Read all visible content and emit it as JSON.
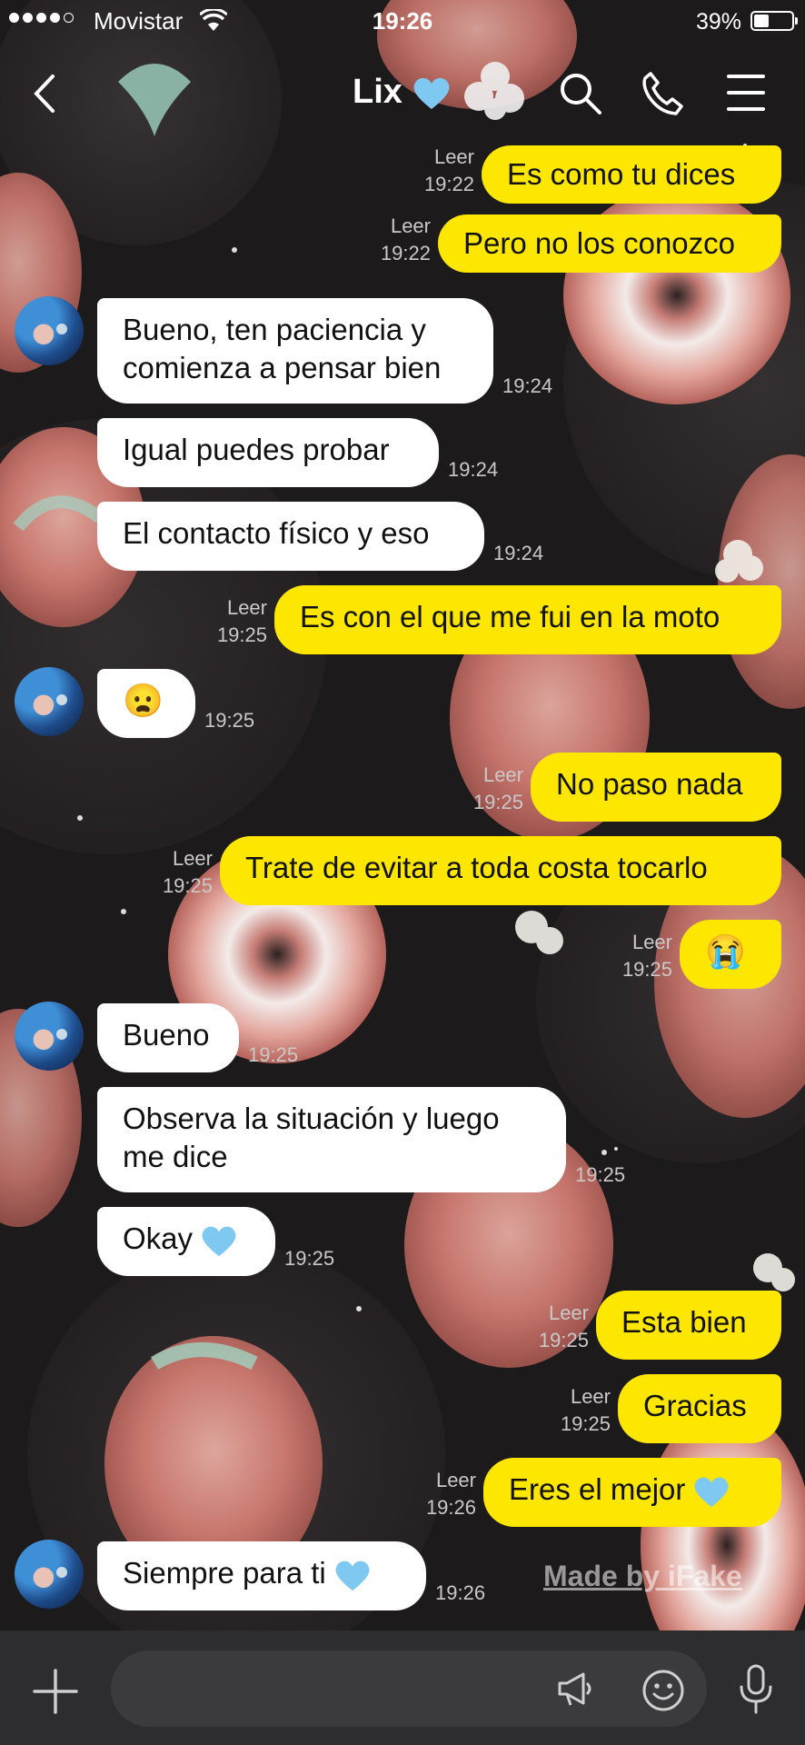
{
  "status_bar": {
    "carrier": "Movistar",
    "time": "19:26",
    "battery_percent_text": "39%",
    "battery_level": 0.39
  },
  "header": {
    "title": "Lix",
    "title_emoji": "blue-heart"
  },
  "messages": [
    {
      "side": "out",
      "text": [
        "Es como tu dices"
      ],
      "read": "Leer",
      "time": "19:22"
    },
    {
      "side": "out",
      "text": [
        "Pero no los conozco"
      ],
      "read": "Leer",
      "time": "19:22"
    },
    {
      "side": "in",
      "avatar": true,
      "text": [
        "Bueno, ten paciencia y",
        "comienza a pensar bien"
      ],
      "time": "19:24"
    },
    {
      "side": "in",
      "text": [
        "Igual puedes probar"
      ],
      "time": "19:24"
    },
    {
      "side": "in",
      "text": [
        "El contacto físico y eso"
      ],
      "time": "19:24"
    },
    {
      "side": "out",
      "text": [
        "Es con el que me fui en la moto"
      ],
      "read": "Leer",
      "time": "19:25"
    },
    {
      "side": "in",
      "avatar": true,
      "emoji": "😦",
      "time": "19:25"
    },
    {
      "side": "out",
      "text": [
        "No paso nada"
      ],
      "read": "Leer",
      "time": "19:25"
    },
    {
      "side": "out",
      "text": [
        "Trate de evitar a toda costa tocarlo"
      ],
      "read": "Leer",
      "time": "19:25"
    },
    {
      "side": "out",
      "emoji": "😭",
      "read": "Leer",
      "time": "19:25"
    },
    {
      "side": "in",
      "avatar": true,
      "text": [
        "Bueno"
      ],
      "time": "19:25"
    },
    {
      "side": "in",
      "text": [
        "Observa la situación y luego",
        "me dice"
      ],
      "time": "19:25"
    },
    {
      "side": "in",
      "text": [
        "Okay"
      ],
      "heart": true,
      "time": "19:25"
    },
    {
      "side": "out",
      "text": [
        "Esta bien"
      ],
      "read": "Leer",
      "time": "19:25"
    },
    {
      "side": "out",
      "text": [
        "Gracias"
      ],
      "read": "Leer",
      "time": "19:25"
    },
    {
      "side": "out",
      "text": [
        "Eres el mejor"
      ],
      "heart": true,
      "read": "Leer",
      "time": "19:26"
    },
    {
      "side": "in",
      "avatar": true,
      "text": [
        "Siempre para ti"
      ],
      "heart": true,
      "time": "19:26"
    }
  ],
  "watermark": "Made by iFake",
  "input": {
    "placeholder": ""
  },
  "icons": {
    "back": "chevron-left-icon",
    "search": "search-icon",
    "call": "phone-icon",
    "menu": "menu-icon",
    "plus": "plus-icon",
    "megaphone": "megaphone-icon",
    "emoji": "smiley-icon",
    "mic": "microphone-icon"
  },
  "colors": {
    "outgoing_bubble": "#fde700",
    "incoming_bubble": "#ffffff",
    "background": "#1d1a1c",
    "input_bar": "#2d2d2f",
    "heart": "#7ec8f2"
  }
}
